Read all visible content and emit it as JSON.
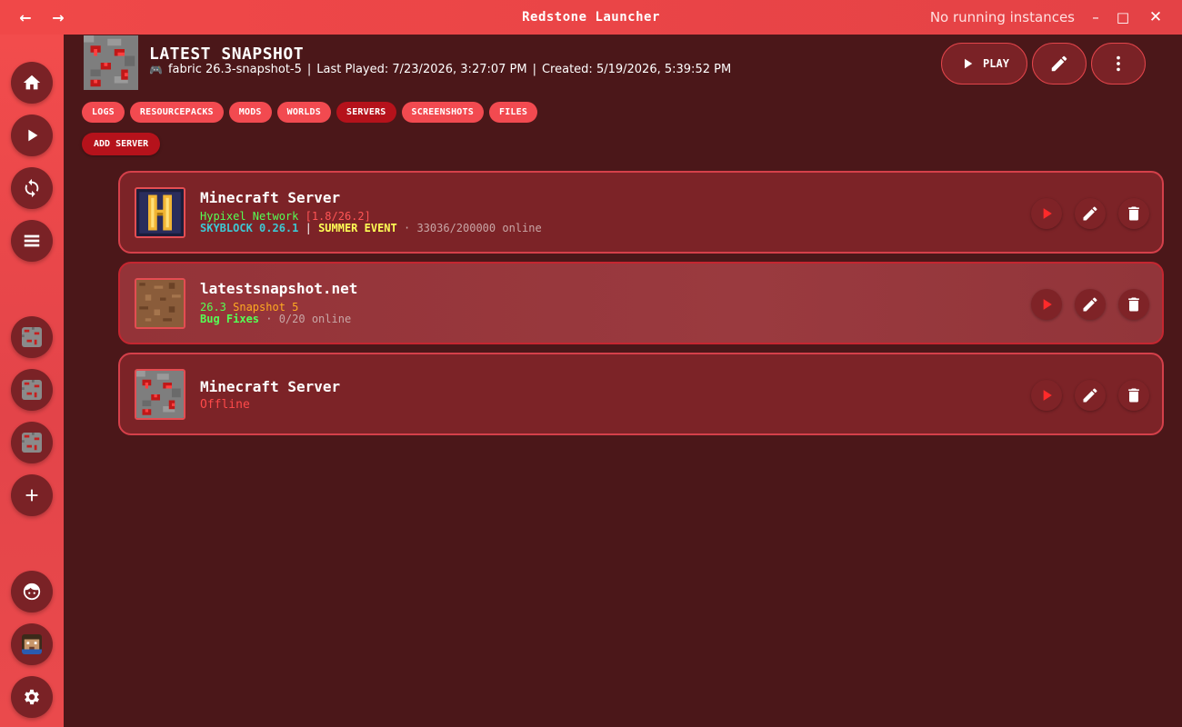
{
  "window": {
    "title": "Redstone Launcher",
    "status": "No running instances",
    "back_icon": "arrow-left-icon",
    "forward_icon": "arrow-right-icon"
  },
  "sidebar": {
    "items": [
      "home-icon",
      "play-icon",
      "sync-icon",
      "list-icon",
      "instance-thumb",
      "instance-thumb",
      "instance-thumb",
      "plus-icon",
      "face-icon",
      "avatar",
      "gear-icon"
    ]
  },
  "instance": {
    "title": "LATEST SNAPSHOT",
    "loader_version": "fabric 26.3-snapshot-5",
    "last_played": "Last Played: 7/23/2026, 3:27:07 PM",
    "created": "Created: 5/19/2026, 5:39:52 PM",
    "separator": "|",
    "play_label": "PLAY"
  },
  "tabs": [
    {
      "label": "LOGS",
      "active": false
    },
    {
      "label": "RESOURCEPACKS",
      "active": false
    },
    {
      "label": "MODS",
      "active": false
    },
    {
      "label": "WORLDS",
      "active": false
    },
    {
      "label": "SERVERS",
      "active": true
    },
    {
      "label": "SCREENSHOTS",
      "active": false
    },
    {
      "label": "FILES",
      "active": false
    }
  ],
  "add_server_label": "ADD SERVER",
  "servers": [
    {
      "name": "Minecraft Server",
      "motd1a": "Hypixel Network ",
      "motd1b": "[1.8/26.2]",
      "motd2a": "SKYBLOCK 0.26.1",
      "motd2sep": " | ",
      "motd2b": "SUMMER EVENT",
      "players": " · 33036/200000 online"
    },
    {
      "name": "latestsnapshot.net",
      "motd1a": "26.3 ",
      "motd1b": "Snapshot 5",
      "motd2a": "Bug Fixes",
      "players": " · 0/20 online"
    },
    {
      "name": "Minecraft Server",
      "status": "Offline"
    }
  ],
  "colors": {
    "accent": "#f04848",
    "background": "#4b1719",
    "card": "#7c2327",
    "active_tab": "#b5121b"
  }
}
